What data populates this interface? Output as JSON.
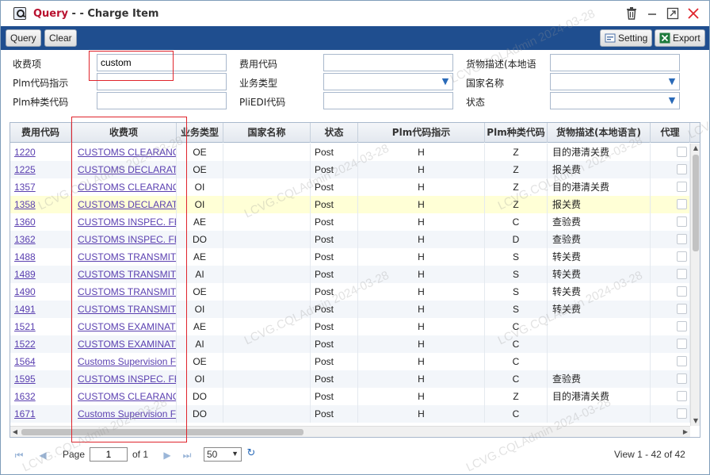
{
  "window": {
    "title_prefix": "Query",
    "title_rest": " - - Charge Item"
  },
  "toolbar": {
    "query_label": "Query",
    "clear_label": "Clear",
    "setting_label": "Setting",
    "export_label": "Export"
  },
  "form": {
    "charge_item_label": "收费项",
    "charge_item_value": "custom",
    "fee_code_label": "费用代码",
    "fee_code_value": "",
    "goods_desc_label": "货物描述(本地语",
    "goods_desc_value": "",
    "plm_code_label": "Plm代码指示",
    "plm_code_value": "",
    "biz_type_label": "业务类型",
    "biz_type_value": "",
    "country_label": "国家名称",
    "country_value": "",
    "plm_type_label": "Plm种类代码",
    "plm_type_value": "",
    "pliedi_label": "PliEDI代码",
    "pliedi_value": "",
    "status_label": "状态",
    "status_value": ""
  },
  "grid": {
    "columns": [
      "费用代码",
      "收费项",
      "业务类型",
      "国家名称",
      "状态",
      "Plm代码指示",
      "Plm种类代码",
      "货物描述(本地语言)",
      "代理"
    ],
    "rows": [
      {
        "code": "1220",
        "item": "CUSTOMS CLEARANCE",
        "biz": "OE",
        "country": "",
        "status": "Post",
        "plm": "H",
        "type": "Z",
        "desc": "目的港清关费"
      },
      {
        "code": "1225",
        "item": "CUSTOMS DECLARATION",
        "biz": "OE",
        "country": "",
        "status": "Post",
        "plm": "H",
        "type": "Z",
        "desc": "报关费"
      },
      {
        "code": "1357",
        "item": "CUSTOMS CLEARANCE",
        "biz": "OI",
        "country": "",
        "status": "Post",
        "plm": "H",
        "type": "Z",
        "desc": "目的港清关费"
      },
      {
        "code": "1358",
        "item": "CUSTOMS DECLARATION",
        "biz": "OI",
        "country": "",
        "status": "Post",
        "plm": "H",
        "type": "Z",
        "desc": "报关费"
      },
      {
        "code": "1360",
        "item": "CUSTOMS INSPEC. FEE",
        "biz": "AE",
        "country": "",
        "status": "Post",
        "plm": "H",
        "type": "C",
        "desc": "查验费"
      },
      {
        "code": "1362",
        "item": "CUSTOMS INSPEC. FEE",
        "biz": "DO",
        "country": "",
        "status": "Post",
        "plm": "H",
        "type": "D",
        "desc": "查验费"
      },
      {
        "code": "1488",
        "item": "CUSTOMS TRANSMIT",
        "biz": "AE",
        "country": "",
        "status": "Post",
        "plm": "H",
        "type": "S",
        "desc": "转关费"
      },
      {
        "code": "1489",
        "item": "CUSTOMS TRANSMIT",
        "biz": "AI",
        "country": "",
        "status": "Post",
        "plm": "H",
        "type": "S",
        "desc": "转关费"
      },
      {
        "code": "1490",
        "item": "CUSTOMS TRANSMIT",
        "biz": "OE",
        "country": "",
        "status": "Post",
        "plm": "H",
        "type": "S",
        "desc": "转关费"
      },
      {
        "code": "1491",
        "item": "CUSTOMS TRANSMIT",
        "biz": "OI",
        "country": "",
        "status": "Post",
        "plm": "H",
        "type": "S",
        "desc": "转关费"
      },
      {
        "code": "1521",
        "item": "CUSTOMS EXAMINATION",
        "biz": "AE",
        "country": "",
        "status": "Post",
        "plm": "H",
        "type": "C",
        "desc": ""
      },
      {
        "code": "1522",
        "item": "CUSTOMS EXAMINATION",
        "biz": "AI",
        "country": "",
        "status": "Post",
        "plm": "H",
        "type": "C",
        "desc": ""
      },
      {
        "code": "1564",
        "item": "Customs Supervision Fee",
        "biz": "OE",
        "country": "",
        "status": "Post",
        "plm": "H",
        "type": "C",
        "desc": ""
      },
      {
        "code": "1595",
        "item": "CUSTOMS INSPEC. FEE",
        "biz": "OI",
        "country": "",
        "status": "Post",
        "plm": "H",
        "type": "C",
        "desc": "查验费"
      },
      {
        "code": "1632",
        "item": "CUSTOMS CLEARANCE",
        "biz": "DO",
        "country": "",
        "status": "Post",
        "plm": "H",
        "type": "Z",
        "desc": "目的港清关费"
      },
      {
        "code": "1671",
        "item": "Customs Supervision Fee",
        "biz": "DO",
        "country": "",
        "status": "Post",
        "plm": "H",
        "type": "C",
        "desc": ""
      }
    ]
  },
  "pager": {
    "page_label": "Page",
    "page_value": "1",
    "of_label": "of 1",
    "page_size": "50",
    "view_text": "View 1 - 42 of 42"
  },
  "watermark_text": "LCVG.CQLAdmin 2024-03-28",
  "colors": {
    "toolbar_bg": "#1f4e8f",
    "title_accent": "#b8102e",
    "link": "#5a3fb0",
    "highlight": "#e0242c",
    "selected_row": "#ffffd6"
  }
}
